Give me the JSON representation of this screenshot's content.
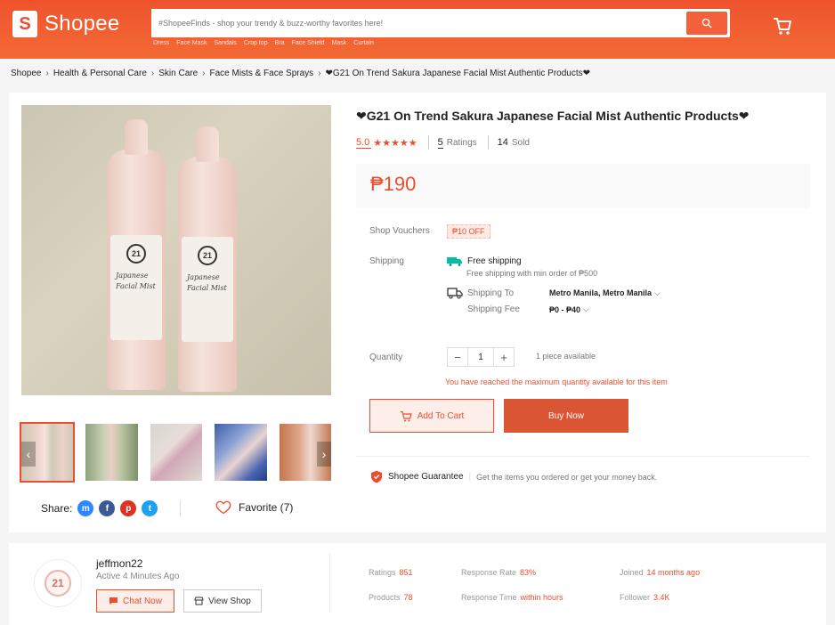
{
  "colors": {
    "brand": "#ee4d2d",
    "header": "#f05d33"
  },
  "header": {
    "logo_text": "Shopee",
    "search_placeholder": "#ShopeeFinds - shop your trendy & buzz-worthy favorites here!",
    "hot_links": [
      "Dress",
      "Face Mask",
      "Sandals",
      "Crop top",
      "Bra",
      "Face Shield",
      "Mask",
      "Curtain"
    ]
  },
  "breadcrumb": [
    "Shopee",
    "Health & Personal Care",
    "Skin Care",
    "Face Mists & Face Sprays",
    "❤G21 On Trend Sakura Japanese Facial Mist Authentic Products❤"
  ],
  "product": {
    "title": "❤G21 On Trend Sakura Japanese Facial Mist Authentic Products❤",
    "rating": "5.0",
    "stars": "★★★★★",
    "rating_count": "5",
    "rating_label": "Ratings",
    "sold_count": "14",
    "sold_label": "Sold",
    "price": "₱190",
    "image_badge": "21",
    "image_script": "Japanese Facial Mist"
  },
  "voucher": {
    "label": "Shop Vouchers",
    "tag": "₱10 OFF"
  },
  "shipping": {
    "label": "Shipping",
    "free_title": "Free shipping",
    "free_sub": "Free shipping with min order of ₱500",
    "to_label": "Shipping To",
    "to_value": "Metro Manila, Metro Manila",
    "fee_label": "Shipping Fee",
    "fee_value": "₱0 - ₱40"
  },
  "quantity": {
    "label": "Quantity",
    "value": "1",
    "available": "1 piece available",
    "warning": "You have reached the maximum quantity available for this item"
  },
  "buttons": {
    "add_to_cart": "Add To Cart",
    "buy_now": "Buy Now"
  },
  "guarantee": {
    "title": "Shopee Guarantee",
    "text": "Get the items you ordered or get your money back."
  },
  "share": {
    "label": "Share:"
  },
  "favorite": {
    "label": "Favorite (7)"
  },
  "shop": {
    "name": "jeffmon22",
    "active": "Active 4 Minutes Ago",
    "chat_label": "Chat Now",
    "view_label": "View Shop",
    "stats": {
      "ratings_label": "Ratings",
      "ratings_value": "851",
      "products_label": "Products",
      "products_value": "78",
      "response_rate_label": "Response Rate",
      "response_rate_value": "83%",
      "response_time_label": "Response Time",
      "response_time_value": "within hours",
      "joined_label": "Joined",
      "joined_value": "14 months ago",
      "follower_label": "Follower",
      "follower_value": "3.4K"
    }
  }
}
